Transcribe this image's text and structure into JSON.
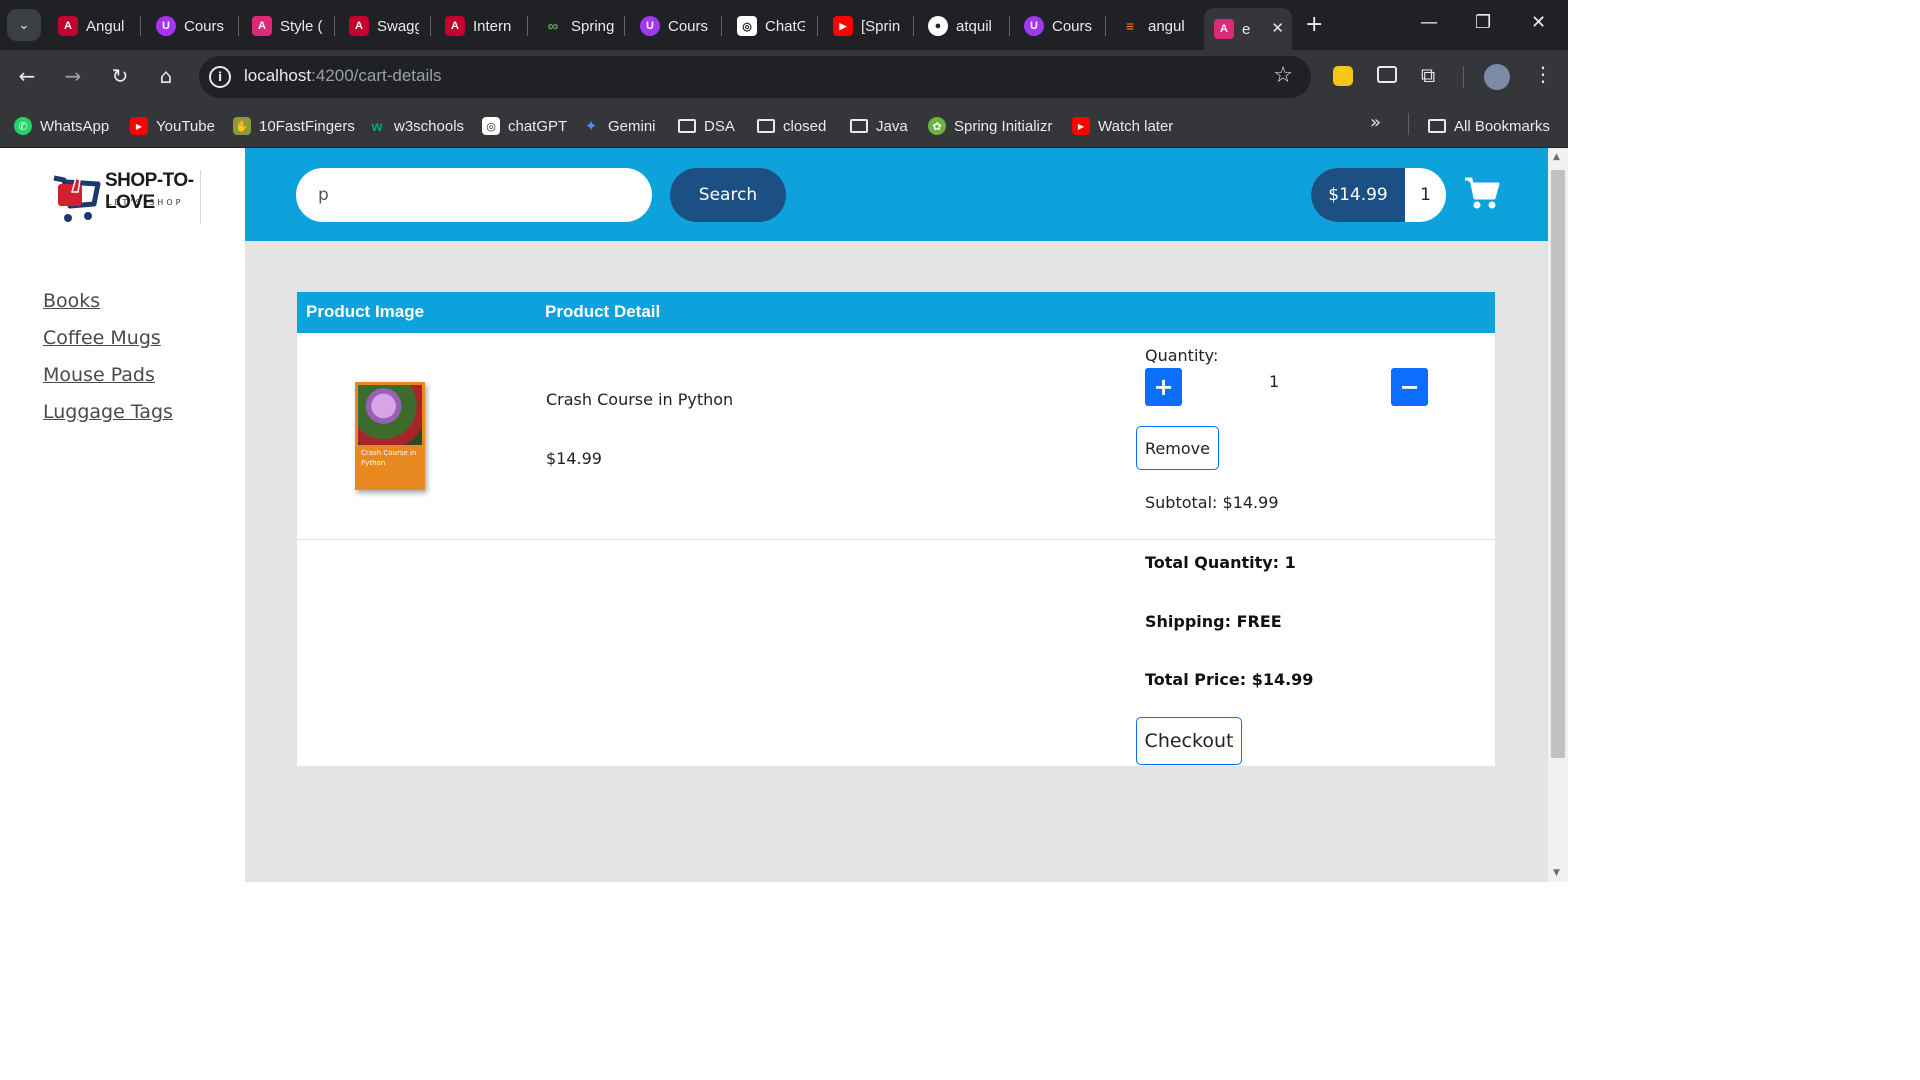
{
  "browser": {
    "tabs": [
      {
        "title": "Angul",
        "color": "#c3002f",
        "glyph": "A"
      },
      {
        "title": "Cours",
        "color": "#a435f0",
        "glyph": "U"
      },
      {
        "title": "Style (",
        "color": "#e0287b",
        "glyph": "A"
      },
      {
        "title": "Swagg",
        "color": "#c3002f",
        "glyph": "A"
      },
      {
        "title": "Intern",
        "color": "#c3002f",
        "glyph": "A"
      },
      {
        "title": "Spring",
        "color": "#5aa55a",
        "glyph": "∞"
      },
      {
        "title": "Cours",
        "color": "#a435f0",
        "glyph": "U"
      },
      {
        "title": "ChatG",
        "color": "#ffffff",
        "glyph": "◎"
      },
      {
        "title": "[Sprin",
        "color": "#ff0000",
        "glyph": "▶"
      },
      {
        "title": "atquil",
        "color": "#ffffff",
        "glyph": "●"
      },
      {
        "title": "Cours",
        "color": "#a435f0",
        "glyph": "U"
      },
      {
        "title": "angul",
        "color": "#f48024",
        "glyph": "≡"
      },
      {
        "title": "e",
        "color": "#e0287b",
        "glyph": "A"
      }
    ],
    "url_host": "localhost",
    "url_path": ":4200/cart-details",
    "bookmarks": [
      {
        "label": "WhatsApp",
        "color": "#25d366",
        "glyph": "✆"
      },
      {
        "label": "YouTube",
        "color": "#ff0000",
        "glyph": "▶"
      },
      {
        "label": "10FastFingers",
        "color": "#8a9a3a",
        "glyph": "✋"
      },
      {
        "label": "w3schools",
        "color": "#04aa6d",
        "glyph": "w"
      },
      {
        "label": "chatGPT",
        "color": "#ffffff",
        "glyph": "◎"
      },
      {
        "label": "Gemini",
        "color": "#4b8bf5",
        "glyph": "✦"
      },
      {
        "label": "DSA",
        "folder": true
      },
      {
        "label": "closed",
        "folder": true
      },
      {
        "label": "Java",
        "folder": true
      },
      {
        "label": "Spring Initializr",
        "color": "#6db33f",
        "glyph": "✿"
      },
      {
        "label": "Watch later",
        "color": "#ff0000",
        "glyph": "▶"
      }
    ],
    "all_bookmarks": "All Bookmarks"
  },
  "brand": {
    "name": "SHOP-TO-LOVE",
    "tagline": "LET'S SHOP"
  },
  "sidebar": {
    "items": [
      "Books",
      "Coffee Mugs",
      "Mouse Pads",
      "Luggage Tags"
    ]
  },
  "header": {
    "search_value": "p",
    "search_button": "Search",
    "cart_total": "$14.99",
    "cart_quantity": "1"
  },
  "table": {
    "col_image": "Product Image",
    "col_detail": "Product Detail",
    "book_cover_title": "Crash Course in Python",
    "item": {
      "name": "Crash Course in Python",
      "price": "$14.99",
      "quantity_label": "Quantity:",
      "quantity": "1",
      "increment": "+",
      "decrement": "−",
      "remove": "Remove",
      "subtotal": "Subtotal: $14.99"
    }
  },
  "summary": {
    "total_quantity": "Total Quantity: 1",
    "shipping": "Shipping: FREE",
    "total_price": "Total Price: $14.99",
    "checkout": "Checkout"
  },
  "colors": {
    "header_blue": "#0ea2dc",
    "button_navy": "#1c4f84",
    "qty_button_blue": "#0d6efd",
    "page_bg": "#e4e4e4"
  }
}
